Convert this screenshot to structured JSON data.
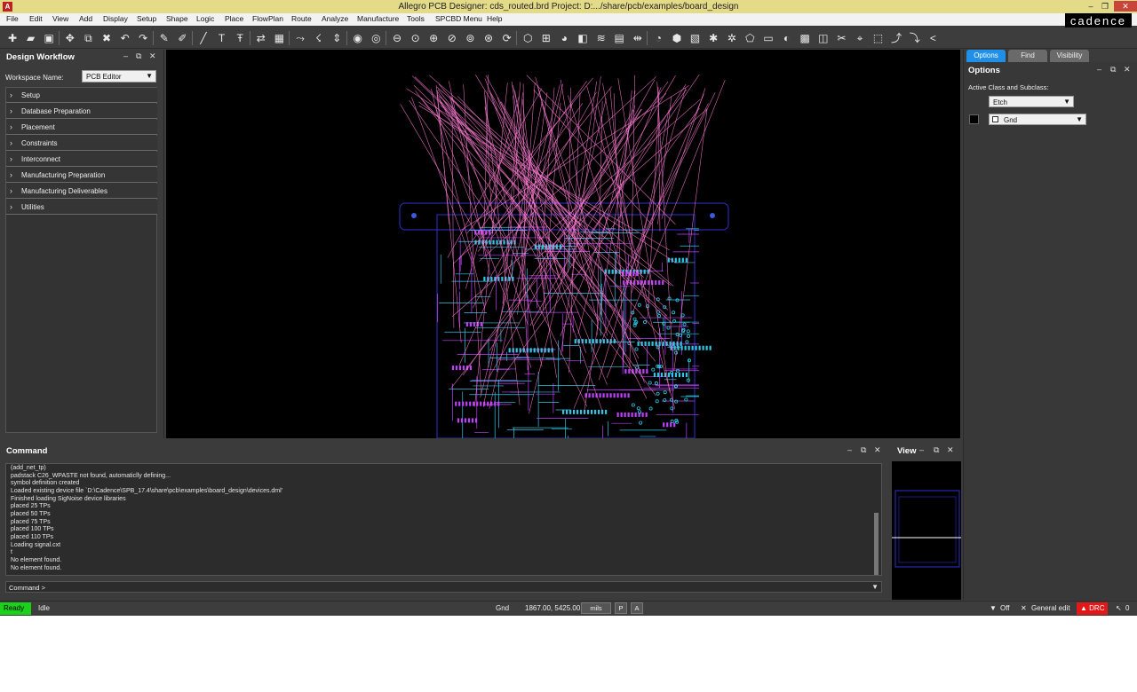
{
  "titlebar": {
    "title": "Allegro PCB Designer: cds_routed.brd  Project: D:.../share/pcb/examples/board_design",
    "app_icon": "A"
  },
  "window_controls": {
    "minimize": "–",
    "restore": "❐",
    "close": "✕"
  },
  "brand": "cadence",
  "menu": [
    "File",
    "Edit",
    "View",
    "Add",
    "Display",
    "Setup",
    "Shape",
    "Logic",
    "Place",
    "FlowPlan",
    "Route",
    "Analyze",
    "Manufacture",
    "Tools",
    "SPCBD Menu",
    "Help"
  ],
  "toolbar_icons": [
    "new-file-icon",
    "open-folder-icon",
    "save-icon",
    "move-icon",
    "copy-icon",
    "delete-icon",
    "undo-icon",
    "redo-icon",
    "pin-icon",
    "unpin-icon",
    "add-line-icon",
    "add-text-icon",
    "edit-text-icon",
    "swap-icon",
    "chip-icon",
    "route-icon",
    "slide-icon",
    "delay-tune-icon",
    "drc-icon",
    "grid-icon",
    "zoom-out-icon",
    "zoom-fit-icon",
    "zoom-in-icon",
    "zoom-prev-icon",
    "zoom-world-icon",
    "zoom-center-icon",
    "refresh-icon",
    "3d-view-icon",
    "grid-toggle-icon",
    "color-icon",
    "shadow-icon",
    "layers-icon",
    "report-icon",
    "measure-icon",
    "visibility-icon",
    "cube-icon",
    "shape-icon",
    "highlight-icon",
    "dehighlight-icon",
    "shape-edit-icon",
    "shape-add-icon",
    "shape-void-icon",
    "shape-merge-icon",
    "edit-vertex-icon",
    "cut-icon",
    "snap-icon",
    "quick-place-icon",
    "export-icon",
    "import-icon",
    "share-icon"
  ],
  "design_workflow": {
    "title": "Design Workflow",
    "workspace_label": "Workspace Name:",
    "workspace_value": "PCB Editor",
    "items": [
      "Setup",
      "Database Preparation",
      "Placement",
      "Constraints",
      "Interconnect",
      "Manufacturing Preparation",
      "Manufacturing Deliverables",
      "Utilities"
    ]
  },
  "options_panel": {
    "tabs": [
      "Options",
      "Find",
      "Visibility"
    ],
    "title": "Options",
    "active_class_label": "Active Class and Subclass:",
    "class_value": "Etch",
    "subclass_value": "Gnd"
  },
  "command": {
    "title": "Command",
    "log": [
      "(add_net_tp)",
      "padstack C26_WPASTE not found, automaticlly defining...",
      "symbol definition created",
      "Loaded existing device file `D:\\Cadence\\SPB_17.4\\share\\pcb\\examples\\board_design\\devices.dml'",
      "Finished loading SigNoise device libraries",
      "placed 25 TPs",
      "placed 50 TPs",
      "placed 75 TPs",
      "placed 100 TPs",
      "placed 110 TPs",
      "Loading signal.cxt",
      "t",
      "No element found.",
      "No element found."
    ],
    "prompt": "Command >"
  },
  "view": {
    "title": "View"
  },
  "status": {
    "state": "Ready",
    "activity": "Idle",
    "subclass": "Gnd",
    "coords": "1867.00, 5425.00",
    "units": "mils",
    "p_btn": "P",
    "a_btn": "A",
    "filter": "Off",
    "mode": "General edit",
    "drc": "DRC",
    "pick_count": "0"
  },
  "colors": {
    "ratsnest": "#ff7bd5",
    "etch_top": "#2ec7e6",
    "etch_bottom": "#c040ff",
    "outline": "#3030d0",
    "ready": "#19d219",
    "drc": "#e31818",
    "tab_active": "#1f8fe8"
  }
}
